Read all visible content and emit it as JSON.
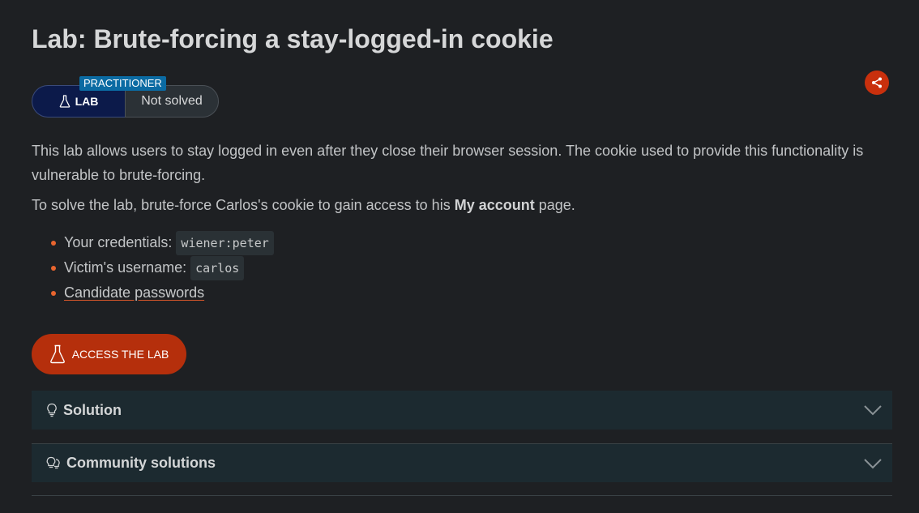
{
  "page": {
    "title": "Lab: Brute-forcing a stay-logged-in cookie"
  },
  "badges": {
    "level": "PRACTITIONER",
    "lab": "LAB",
    "status": "Not solved"
  },
  "content": {
    "description": "This lab allows users to stay logged in even after they close their browser session. The cookie used to provide this functionality is vulnerable to brute-forcing.",
    "task_prefix": "To solve the lab, brute-force Carlos's cookie to gain access to his ",
    "task_bold": "My account",
    "task_suffix": " page.",
    "credentials_label": "Your credentials:",
    "credentials_value": "wiener:peter",
    "victim_label": "Victim's username:",
    "victim_value": "carlos",
    "candidate_link": "Candidate passwords"
  },
  "actions": {
    "access_label": "ACCESS THE LAB"
  },
  "panels": {
    "solution": "Solution",
    "community": "Community solutions"
  },
  "icons": {
    "share": "share-icon",
    "flask": "flask-icon",
    "bulb": "lightbulb-icon",
    "bulbs": "double-lightbulb-icon",
    "chevron": "chevron-down-icon"
  },
  "colors": {
    "background": "#1e2023",
    "accent": "#c9300d",
    "level_badge": "#0b6ba3",
    "lab_badge": "#0c1a4a",
    "panel": "#1c2a30"
  }
}
